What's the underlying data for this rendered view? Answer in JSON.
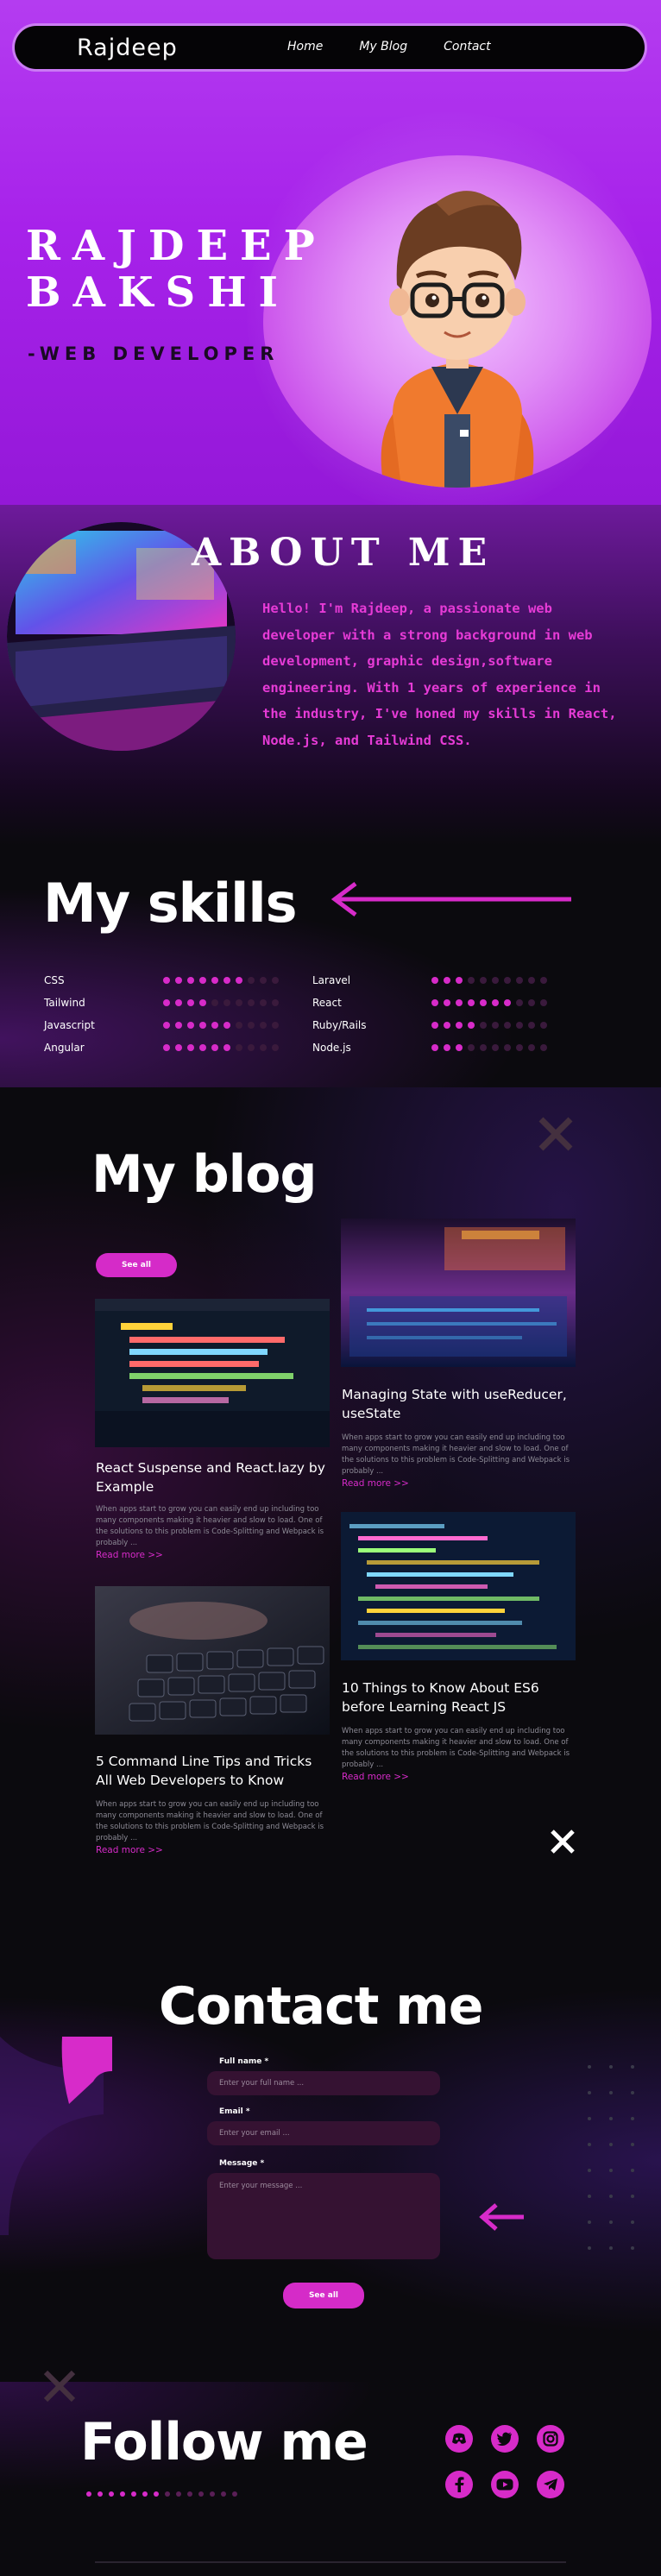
{
  "nav": {
    "brand": "Rajdeep",
    "links": [
      "Home",
      "My Blog",
      "Contact"
    ]
  },
  "hero": {
    "name_line1": "RAJDEEP",
    "name_line2": "BAKSHI",
    "role": "-WEB DEVELOPER"
  },
  "about": {
    "title": "ABOUT ME",
    "text": "Hello! I'm Rajdeep, a passionate web developer with a strong background in  web development, graphic design,software engineering. With 1 years of experience in the industry, I've honed my skills in React, Node.js, and Tailwind CSS."
  },
  "skills": {
    "title": "My skills",
    "items": [
      {
        "label": "CSS",
        "level": 0.7
      },
      {
        "label": "Tailwind",
        "level": 0.4
      },
      {
        "label": "Javascript",
        "level": 0.6
      },
      {
        "label": "Angular",
        "level": 0.6
      },
      {
        "label": "Laravel",
        "level": 0.3
      },
      {
        "label": "React",
        "level": 0.7
      },
      {
        "label": "Ruby/Rails",
        "level": 0.4
      },
      {
        "label": "Node.js",
        "level": 0.3
      }
    ]
  },
  "blog": {
    "title": "My blog",
    "see_all": "See all",
    "read_more": "Read more >>",
    "excerpt": "When apps start to grow you can easily end up including too many components making it heavier and slow to load. One of the solutions to this problem is Code-Splitting and Webpack is probably ...",
    "posts": [
      {
        "title": "React Suspense and React.lazy by Example"
      },
      {
        "title": "Managing State with useReducer, useState"
      },
      {
        "title": "5 Command Line Tips and Tricks All Web Developers to Know"
      },
      {
        "title": "10 Things to Know About ES6 before Learning React JS"
      }
    ]
  },
  "contact": {
    "title": "Contact me",
    "fullname_label": "Full name *",
    "fullname_placeholder": "Enter your full name ...",
    "email_label": "Email *",
    "email_placeholder": "Enter your email ...",
    "message_label": "Message *",
    "message_placeholder": "Enter your message ...",
    "submit": "See all"
  },
  "follow": {
    "title": "Follow me",
    "socials": [
      "discord-icon",
      "twitter-icon",
      "instagram-icon",
      "facebook-icon",
      "youtube-icon",
      "telegram-icon"
    ]
  },
  "colors": {
    "accent": "#d72bc9",
    "hero_bg": "#a722ea",
    "page_bg": "#0b0a0e"
  }
}
